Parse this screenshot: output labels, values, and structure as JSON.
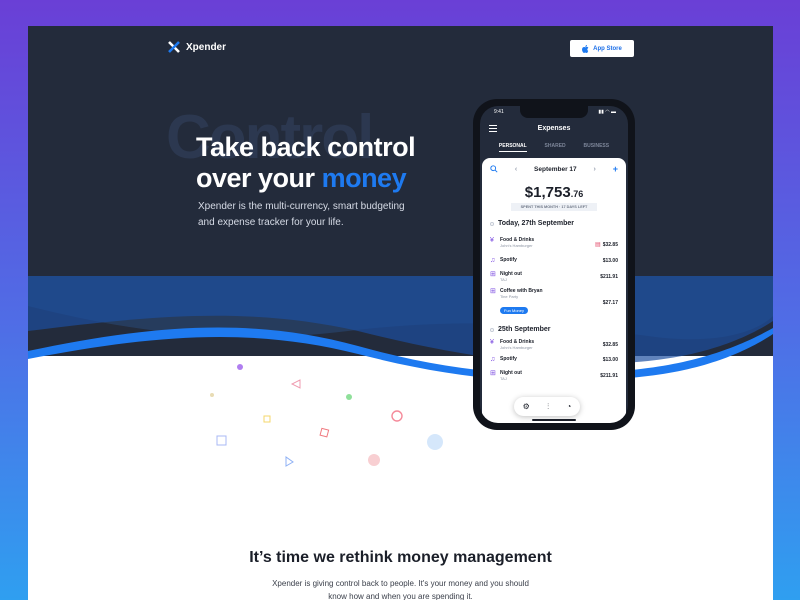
{
  "brand": {
    "name": "Xpender"
  },
  "nav": {
    "app_store_label": "App Store"
  },
  "hero": {
    "bg_word": "Control",
    "headline_line1": "Take back control",
    "headline_line2_prefix": "over your",
    "headline_line2_accent": "money",
    "subtext": "Xpender is the multi-currency, smart budgeting and expense tracker for your life."
  },
  "phone": {
    "status_time": "9:41",
    "status_icons": "▮▮ ◠ ▬",
    "title": "Expenses",
    "tabs": [
      "PERSONAL",
      "SHARED",
      "BUSINESS"
    ],
    "date": "September 17",
    "amount_main": "$1,753",
    "amount_cents": ".76",
    "amount_caption": "SPENT THIS MONTH · 17 DAYS LEFT",
    "sections": [
      {
        "day": "Today, 27th September",
        "items": [
          {
            "title": "Food & Drinks",
            "sub": "John's Hamburger",
            "amount": "$32.85",
            "icon": "fork-knife-icon"
          },
          {
            "title": "Spotify",
            "sub": "",
            "amount": "$13.00",
            "icon": "music-icon"
          },
          {
            "title": "Night out",
            "sub": "TAJ",
            "amount": "$211.91",
            "icon": "ticket-icon"
          },
          {
            "title": "Coffee with Bryan",
            "sub": "Tine Party",
            "amount": "$27.17",
            "icon": "ticket-icon",
            "tag": "Fun Money"
          }
        ]
      },
      {
        "day": "25th September",
        "items": [
          {
            "title": "Food & Drinks",
            "sub": "John's Hamburger",
            "amount": "$32.85",
            "icon": "fork-knife-icon"
          },
          {
            "title": "Spotify",
            "sub": "",
            "amount": "$13.00",
            "icon": "music-icon"
          },
          {
            "title": "Night out",
            "sub": "TAJ",
            "amount": "$211.91",
            "icon": "ticket-icon"
          }
        ]
      }
    ]
  },
  "section": {
    "title": "It’s time we rethink money management",
    "text": "Xpender is giving control back to people. It's your money and you should know how and when you are spending it."
  },
  "colors": {
    "accent": "#1e7af0",
    "hero_bg": "#232b3b",
    "page_bg_top": "#6a3fd6",
    "page_bg_bottom": "#2f9ff0"
  }
}
